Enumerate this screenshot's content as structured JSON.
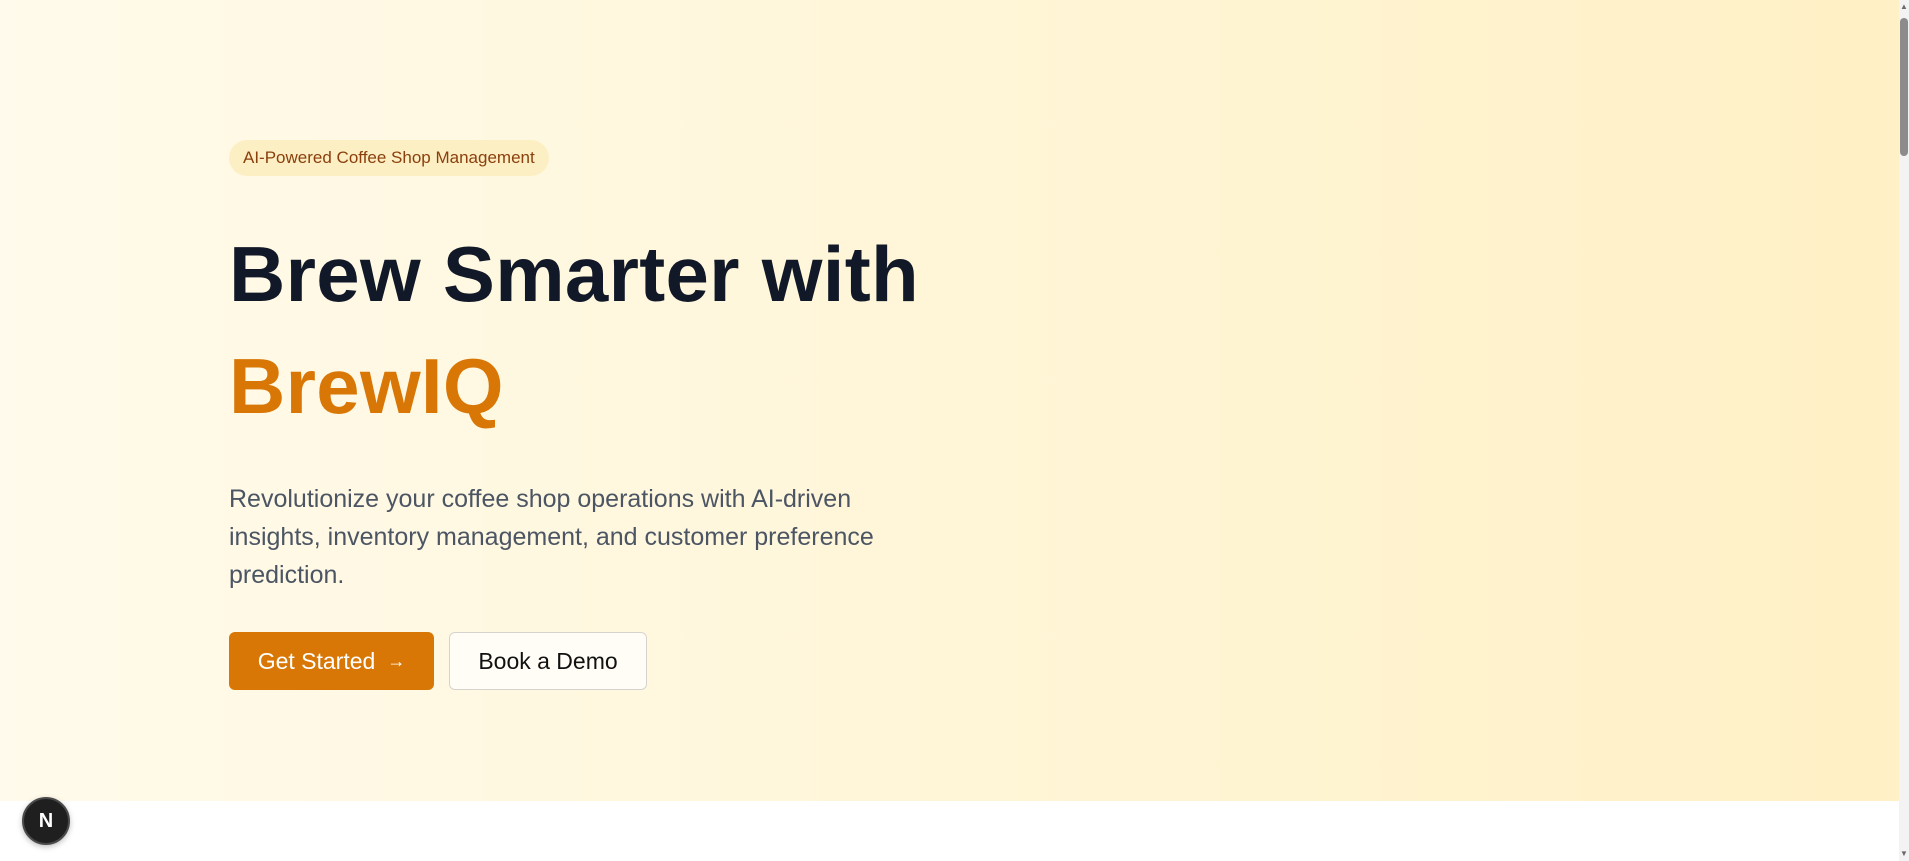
{
  "hero": {
    "badge": "AI-Powered Coffee Shop Management",
    "headline_line1": "Brew Smarter with",
    "headline_brand": "BrewIQ",
    "description": "Revolutionize your coffee shop operations with AI-driven insights, inventory management, and customer preference prediction.",
    "primary_button": "Get Started",
    "primary_button_icon": "→",
    "secondary_button": "Book a Demo"
  },
  "dev_indicator": {
    "label": "N"
  },
  "colors": {
    "accent": "#d97706",
    "heading": "#111827",
    "body_text": "#4b5563",
    "badge_bg": "#fdefc4",
    "badge_text": "#8a3f0c"
  }
}
